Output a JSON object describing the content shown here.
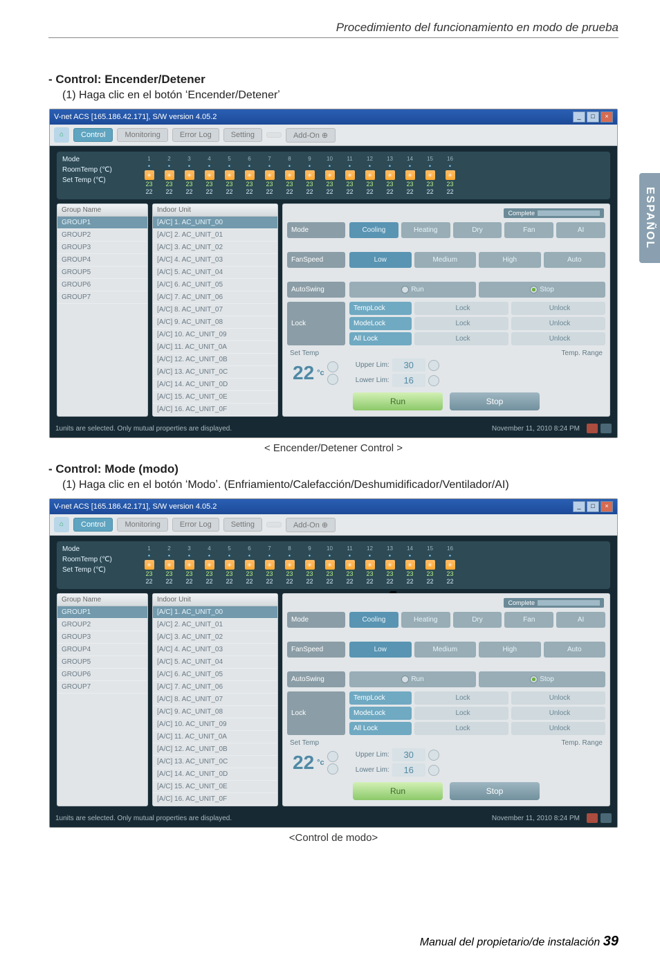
{
  "page": {
    "header_title": "Procedimiento del funcionamiento en modo de prueba",
    "footer_text": "Manual del propietario/de instalación",
    "footer_page": "39",
    "side_tab": "ESPAÑOL"
  },
  "sec1": {
    "title": "- Control: Encender/Detener",
    "desc": "(1) Haga clic en el botón ʻEncender/Detenerʼ",
    "caption": "< Encender/Detener Control >"
  },
  "sec2": {
    "title": "- Control: Mode (modo)",
    "desc": "(1) Haga clic en el botón ʻModoʼ. (Enfriamiento/Calefacción/Deshumidificador/Ventilador/AI)",
    "caption": "<Control de modo>"
  },
  "app": {
    "title": "V-net ACS [165.186.42.171],   S/W version 4.05.2",
    "nav": {
      "home": "Home",
      "control": "Control",
      "monitoring": "Monitoring",
      "errorlog": "Error Log",
      "setting": "Setting",
      "addon": "Add-On"
    },
    "top": {
      "mode": "Mode",
      "roomtemp": "RoomTemp (℃)",
      "settemp": "Set Temp   (℃)",
      "room_val": "23",
      "set_val": "22",
      "count": 16
    },
    "group": {
      "header": "Group Name",
      "items": [
        "GROUP1",
        "GROUP2",
        "GROUP3",
        "GROUP4",
        "GROUP5",
        "GROUP6",
        "GROUP7"
      ]
    },
    "indoor": {
      "header": "Indoor Unit",
      "items": [
        "[A/C] 1. AC_UNIT_00",
        "[A/C] 2. AC_UNIT_01",
        "[A/C] 3. AC_UNIT_02",
        "[A/C] 4. AC_UNIT_03",
        "[A/C] 5. AC_UNIT_04",
        "[A/C] 6. AC_UNIT_05",
        "[A/C] 7. AC_UNIT_06",
        "[A/C] 8. AC_UNIT_07",
        "[A/C] 9. AC_UNIT_08",
        "[A/C] 10. AC_UNIT_09",
        "[A/C] 11. AC_UNIT_0A",
        "[A/C] 12. AC_UNIT_0B",
        "[A/C] 13. AC_UNIT_0C",
        "[A/C] 14. AC_UNIT_0D",
        "[A/C] 15. AC_UNIT_0E",
        "[A/C] 16. AC_UNIT_0F"
      ]
    },
    "panel": {
      "complete": "Complete",
      "mode": {
        "label": "Mode",
        "opts": [
          "Cooling",
          "Heating",
          "Dry",
          "Fan",
          "AI"
        ],
        "sel": 0
      },
      "fan": {
        "label": "FanSpeed",
        "opts": [
          "Low",
          "Medium",
          "High",
          "Auto"
        ],
        "sel": 0
      },
      "swing": {
        "label": "AutoSwing",
        "run": "Run",
        "stop": "Stop"
      },
      "lock": {
        "label": "Lock",
        "rows": [
          {
            "name": "TempLock",
            "a": "Lock",
            "b": "Unlock"
          },
          {
            "name": "ModeLock",
            "a": "Lock",
            "b": "Unlock"
          },
          {
            "name": "All Lock",
            "a": "Lock",
            "b": "Unlock"
          }
        ]
      },
      "settemp": {
        "head_l": "Set Temp",
        "head_r": "Temp. Range",
        "temp": "22",
        "unit": "°c",
        "upper_l": "Upper Lim:",
        "upper_v": "30",
        "lower_l": "Lower Lim:",
        "lower_v": "16"
      },
      "run": "Run",
      "stop": "Stop"
    },
    "status": {
      "text": "1units are selected. Only mutual properties are displayed.",
      "date": "November 11, 2010  8:24 PM"
    }
  }
}
